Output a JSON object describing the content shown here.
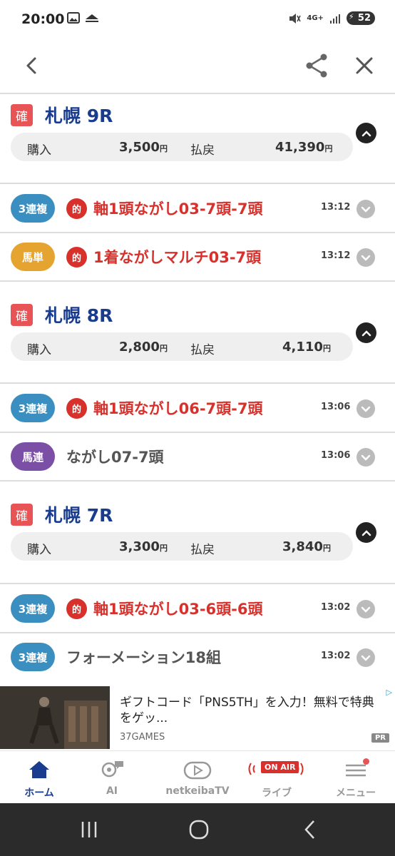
{
  "status": {
    "time": "20:00",
    "network": "4G+",
    "battery": "52"
  },
  "races": [
    {
      "badge": "確",
      "title": "札幌 9R",
      "purchase_label": "購入",
      "purchase_value": "3,500",
      "payout_label": "払戻",
      "payout_value": "41,390",
      "yen": "円",
      "bets": [
        {
          "type": "3連複",
          "type_color": "#3b8fc0",
          "hit": true,
          "hit_label": "的",
          "text": "軸1頭ながし03-7頭-7頭",
          "time": "13:12"
        },
        {
          "type": "馬単",
          "type_color": "#e5a330",
          "hit": true,
          "hit_label": "的",
          "text": "1着ながしマルチ03-7頭",
          "time": "13:12"
        }
      ]
    },
    {
      "badge": "確",
      "title": "札幌 8R",
      "purchase_label": "購入",
      "purchase_value": "2,800",
      "payout_label": "払戻",
      "payout_value": "4,110",
      "yen": "円",
      "bets": [
        {
          "type": "3連複",
          "type_color": "#3b8fc0",
          "hit": true,
          "hit_label": "的",
          "text": "軸1頭ながし06-7頭-7頭",
          "time": "13:06"
        },
        {
          "type": "馬連",
          "type_color": "#7b4fa5",
          "hit": false,
          "hit_label": "",
          "text": "ながし07-7頭",
          "time": "13:06"
        }
      ]
    },
    {
      "badge": "確",
      "title": "札幌 7R",
      "purchase_label": "購入",
      "purchase_value": "3,300",
      "payout_label": "払戻",
      "payout_value": "3,840",
      "yen": "円",
      "bets": [
        {
          "type": "3連複",
          "type_color": "#3b8fc0",
          "hit": true,
          "hit_label": "的",
          "text": "軸1頭ながし03-6頭-6頭",
          "time": "13:02"
        },
        {
          "type": "3連複",
          "type_color": "#3b8fc0",
          "hit": false,
          "hit_label": "",
          "text": "フォーメーション18組",
          "time": "13:02"
        }
      ]
    }
  ],
  "ad": {
    "text": "ギフトコード「PNS5TH」を入力！無料で特典をゲッ...",
    "source": "37GAMES",
    "badge": "PR"
  },
  "bottom_nav": [
    {
      "label": "ホーム",
      "icon": "home-icon",
      "active": true
    },
    {
      "label": "AI",
      "icon": "ai-icon",
      "active": false
    },
    {
      "label": "netkeibaTV",
      "icon": "play-icon",
      "active": false
    },
    {
      "label": "ライブ",
      "icon": "live-icon",
      "active": false,
      "badge": "ON AIR"
    },
    {
      "label": "メニュー",
      "icon": "menu-icon",
      "active": false
    }
  ],
  "colors": {
    "accent_blue": "#1a3c8f",
    "hit_red": "#d8312c",
    "confirm_red": "#e85456"
  }
}
